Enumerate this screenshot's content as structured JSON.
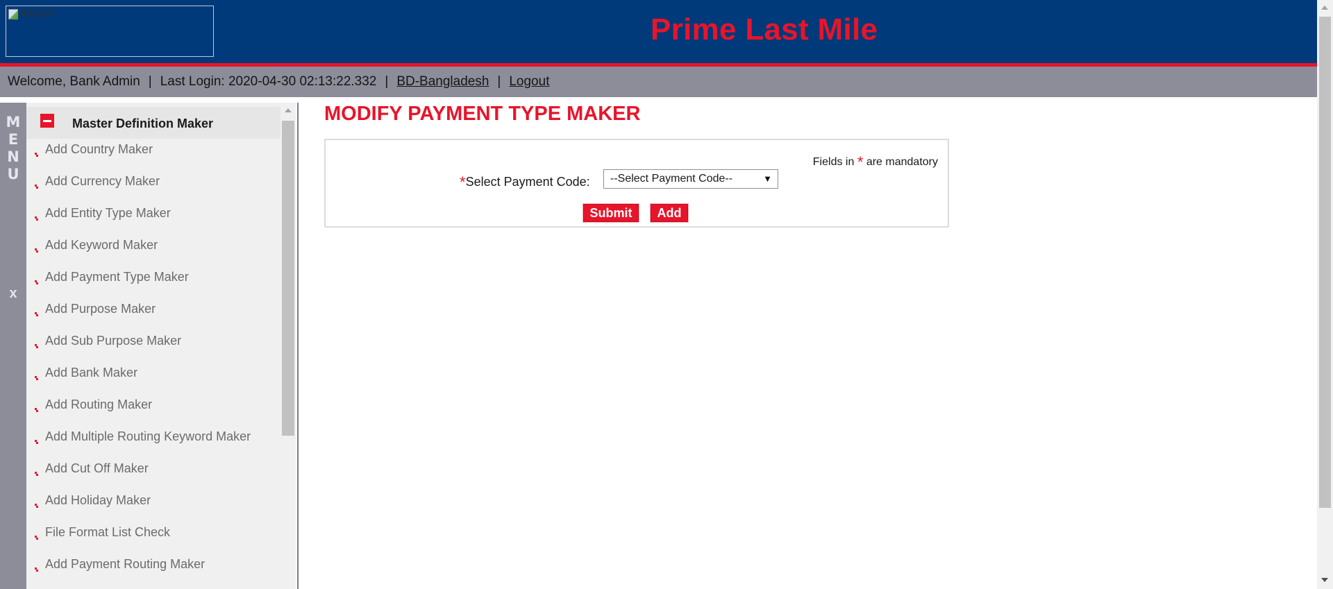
{
  "header": {
    "logo_alt": "Header",
    "app_title": "Prime Last Mile"
  },
  "infobar": {
    "welcome": "Welcome, Bank Admin",
    "last_login": "Last Login: 2020-04-30 02:13:22.332",
    "region": "BD-Bangladesh",
    "logout": "Logout",
    "separator": "|"
  },
  "menu_strip": {
    "letters": [
      "M",
      "E",
      "N",
      "U"
    ],
    "close_glyph": "x"
  },
  "sidebar": {
    "section_title": "Master Definition Maker",
    "items": [
      {
        "label": "Add Country Maker"
      },
      {
        "label": "Add Currency Maker"
      },
      {
        "label": "Add Entity Type Maker"
      },
      {
        "label": "Add Keyword Maker"
      },
      {
        "label": "Add Payment Type Maker"
      },
      {
        "label": "Add Purpose Maker"
      },
      {
        "label": "Add Sub Purpose Maker"
      },
      {
        "label": "Add Bank Maker"
      },
      {
        "label": "Add Routing Maker"
      },
      {
        "label": "Add Multiple Routing Keyword Maker"
      },
      {
        "label": "Add Cut Off Maker"
      },
      {
        "label": "Add Holiday Maker"
      },
      {
        "label": "File Format List Check"
      },
      {
        "label": "Add Payment Routing Maker"
      }
    ]
  },
  "main": {
    "page_title": "MODIFY PAYMENT TYPE MAKER",
    "mandatory_prefix": "Fields in",
    "mandatory_star": "*",
    "mandatory_suffix": "are mandatory",
    "payment_code_label": "Select Payment Code:",
    "payment_code_selected": "--Select Payment Code--",
    "submit_label": "Submit",
    "add_label": "Add"
  },
  "colors": {
    "header_bg": "#003a7a",
    "accent_red": "#e8142a",
    "infobar_bg": "#8c8d99",
    "sidebar_bg": "#f0f0f0"
  },
  "icons": {
    "logo": "broken-image-icon",
    "collapse": "minus-icon",
    "bullet": "bullet-arrow-icon",
    "dropdown": "chevron-down-icon"
  }
}
